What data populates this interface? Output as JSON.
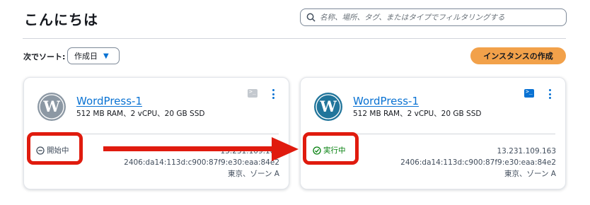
{
  "header": {
    "title": "こんにちは",
    "search_placeholder": "名称、場所、タグ、またはタイプでフィルタリングする"
  },
  "toolbar": {
    "sort_label": "次でソート:",
    "sort_value": "作成日",
    "create_button": "インスタンスの作成"
  },
  "instances": [
    {
      "name": "WordPress-1",
      "specs": "512 MB RAM、2 vCPU、20 GB SSD",
      "status": "開始中",
      "ipv4": "13.231.109.163",
      "ipv6": "2406:da14:113d:c900:87f9:e30:eaa:84e2",
      "location": "東京、ゾーン A"
    },
    {
      "name": "WordPress-1",
      "specs": "512 MB RAM、2 vCPU、20 GB SSD",
      "status": "実行中",
      "ipv4": "13.231.109.163",
      "ipv6": "2406:da14:113d:c900:87f9:e30:eaa:84e2",
      "location": "東京、ゾーン A"
    }
  ],
  "colors": {
    "accent": "#0972d3",
    "create_button": "#f2a14a",
    "running": "#037f0c",
    "annotation": "#e01b0e"
  },
  "icons": [
    "search-icon",
    "caret-down-icon",
    "wordpress-logo",
    "terminal-icon",
    "kebab-menu-icon",
    "pending-status-icon",
    "success-status-icon",
    "annotation-arrow"
  ]
}
